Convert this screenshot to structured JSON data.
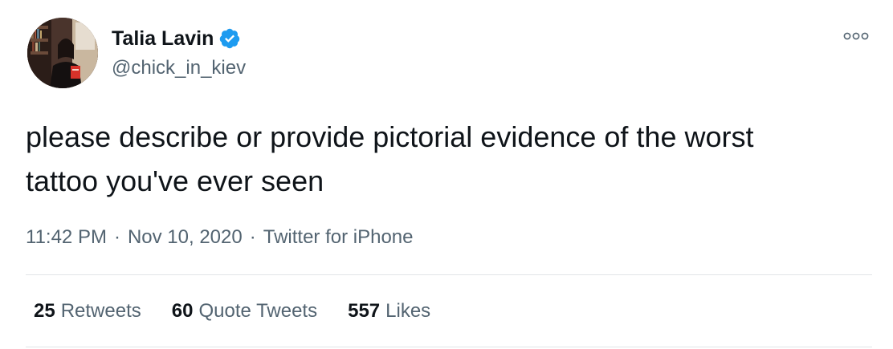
{
  "tweet": {
    "author": {
      "display_name": "Talia Lavin",
      "handle": "@chick_in_kiev",
      "verified": true,
      "verified_icon": "verified-badge-icon"
    },
    "more_icon": "more-options-icon",
    "text": "please describe or provide pictorial evidence of the worst\ntattoo you've ever seen",
    "meta": {
      "time": "11:42 PM",
      "date": "Nov 10, 2020",
      "separator": "·",
      "source": "Twitter for iPhone"
    },
    "stats": [
      {
        "count": "25",
        "label": "Retweets"
      },
      {
        "count": "60",
        "label": "Quote Tweets"
      },
      {
        "count": "557",
        "label": "Likes"
      }
    ]
  },
  "colors": {
    "text_primary": "#0f1419",
    "text_secondary": "#536471",
    "verified_blue": "#1d9bf0",
    "divider": "#e1e4e8"
  }
}
